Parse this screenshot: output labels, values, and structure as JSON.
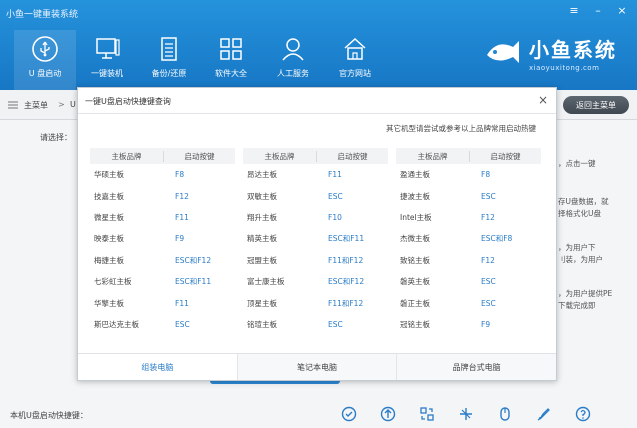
{
  "window": {
    "title": "小鱼一键重装系统",
    "controls": [
      "≡",
      "–",
      "×"
    ]
  },
  "nav": {
    "items": [
      {
        "label": "U 盘启动",
        "icon": "usb-icon",
        "active": true
      },
      {
        "label": "一键装机",
        "icon": "monitor-icon",
        "active": false
      },
      {
        "label": "备份/还原",
        "icon": "document-icon",
        "active": false
      },
      {
        "label": "软件大全",
        "icon": "grid-apps-icon",
        "active": false
      },
      {
        "label": "人工服务",
        "icon": "person-service-icon",
        "active": false
      },
      {
        "label": "官方网站",
        "icon": "globe-icon",
        "active": false
      }
    ]
  },
  "brand": {
    "name": "小鱼系统",
    "url": "xiaoyuxitong.com"
  },
  "breadcrumb": {
    "main": "主菜单",
    "sep": ">",
    "current": "U",
    "back_label": "返回主菜单"
  },
  "background": {
    "select_label": "请选择：",
    "side_lines": [
      "，点击一键",
      "存U盘数据，就",
      "择格式化U盘",
      "，为用户下",
      "刂装，为用户",
      "，为用户提供PE",
      "下载完成即"
    ],
    "status_label": "本机U盘启动快捷键："
  },
  "dialog": {
    "title": "一键U盘启动快捷键查询",
    "close_label": "×",
    "note": "其它机型请尝试或参考以上品牌常用启动热键",
    "col_header_brand": "主板品牌",
    "col_header_key": "启动按键",
    "columns": [
      [
        {
          "brand": "华硕主板",
          "key": "F8"
        },
        {
          "brand": "技嘉主板",
          "key": "F12"
        },
        {
          "brand": "微星主板",
          "key": "F11"
        },
        {
          "brand": "映泰主板",
          "key": "F9"
        },
        {
          "brand": "梅捷主板",
          "key": "ESC和F12"
        },
        {
          "brand": "七彩虹主板",
          "key": "ESC和F11"
        },
        {
          "brand": "华擎主板",
          "key": "F11"
        },
        {
          "brand": "斯巴达克主板",
          "key": "ESC"
        }
      ],
      [
        {
          "brand": "昂达主板",
          "key": "F11"
        },
        {
          "brand": "双敏主板",
          "key": "ESC"
        },
        {
          "brand": "翔升主板",
          "key": "F10"
        },
        {
          "brand": "精英主板",
          "key": "ESC和F11"
        },
        {
          "brand": "冠盟主板",
          "key": "F11和F12"
        },
        {
          "brand": "富士康主板",
          "key": "ESC和F12"
        },
        {
          "brand": "顶星主板",
          "key": "F11和F12"
        },
        {
          "brand": "铭瑄主板",
          "key": "ESC"
        }
      ],
      [
        {
          "brand": "盈通主板",
          "key": "F8"
        },
        {
          "brand": "捷波主板",
          "key": "ESC"
        },
        {
          "brand": "Intel主板",
          "key": "F12"
        },
        {
          "brand": "杰微主板",
          "key": "ESC和F8"
        },
        {
          "brand": "致铭主板",
          "key": "F12"
        },
        {
          "brand": "磐英主板",
          "key": "ESC"
        },
        {
          "brand": "磐正主板",
          "key": "ESC"
        },
        {
          "brand": "冠铭主板",
          "key": "F9"
        }
      ]
    ],
    "tabs": [
      {
        "label": "组装电脑",
        "active": true
      },
      {
        "label": "笔记本电脑",
        "active": false
      },
      {
        "label": "品牌台式电脑",
        "active": false
      }
    ]
  },
  "bottom_tools": [
    "check-circle-icon",
    "upload-arrow-icon",
    "convert-icon",
    "mode-switch-icon",
    "mouse-icon",
    "brush-icon",
    "help-icon"
  ],
  "colors": {
    "header_blue": "#1e86d3",
    "link_blue": "#2a7cc8"
  }
}
